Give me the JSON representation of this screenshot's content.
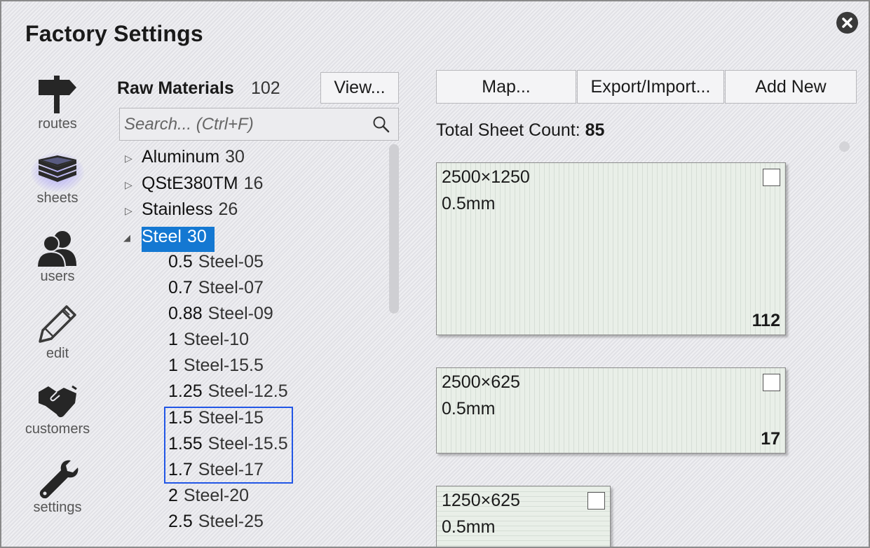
{
  "window": {
    "title": "Factory Settings"
  },
  "nav": {
    "items": [
      {
        "id": "routes",
        "label": "routes",
        "icon": "signpost-icon"
      },
      {
        "id": "sheets",
        "label": "sheets",
        "icon": "stacked-sheets-icon",
        "active": true
      },
      {
        "id": "users",
        "label": "users",
        "icon": "users-icon"
      },
      {
        "id": "edit",
        "label": "edit",
        "icon": "pencil-icon"
      },
      {
        "id": "customers",
        "label": "customers",
        "icon": "handshake-icon"
      },
      {
        "id": "settings",
        "label": "settings",
        "icon": "wrench-icon"
      }
    ]
  },
  "materials": {
    "title": "Raw Materials",
    "count": "102",
    "view_button": "View...",
    "search_placeholder": "Search... (Ctrl+F)",
    "groups": [
      {
        "name": "Aluminum",
        "count": "30",
        "expanded": false
      },
      {
        "name": "QStE380TM",
        "count": "16",
        "expanded": false
      },
      {
        "name": "Stainless",
        "count": "26",
        "expanded": false
      },
      {
        "name": "Steel",
        "count": "30",
        "expanded": true,
        "selected": true
      }
    ],
    "steel_items": [
      {
        "thickness": "0.5",
        "name": "Steel-05"
      },
      {
        "thickness": "0.7",
        "name": "Steel-07"
      },
      {
        "thickness": "0.88",
        "name": "Steel-09"
      },
      {
        "thickness": "1",
        "name": "Steel-10"
      },
      {
        "thickness": "1",
        "name": "Steel-15.5"
      },
      {
        "thickness": "1.25",
        "name": "Steel-12.5"
      },
      {
        "thickness": "1.5",
        "name": "Steel-15"
      },
      {
        "thickness": "1.55",
        "name": "Steel-15.5"
      },
      {
        "thickness": "1.7",
        "name": "Steel-17"
      },
      {
        "thickness": "2",
        "name": "Steel-20"
      },
      {
        "thickness": "2.5",
        "name": "Steel-25"
      }
    ]
  },
  "toolbar": {
    "map_button": "Map...",
    "export_import_button": "Export/Import...",
    "add_new_button": "Add New"
  },
  "sheets": {
    "total_label": "Total Sheet Count:",
    "total_value": "85",
    "cards": [
      {
        "dims": "2500×1250",
        "thickness": "0.5mm",
        "qty": "112",
        "checked": false
      },
      {
        "dims": "2500×625",
        "thickness": "0.5mm",
        "qty": "17",
        "checked": false
      },
      {
        "dims": "1250×625",
        "thickness": "0.5mm",
        "qty": "",
        "checked": false
      }
    ]
  },
  "colors": {
    "selection": "#1478d2",
    "highlight_box": "#2156e6",
    "sheet_fill": "#e9efe8"
  }
}
